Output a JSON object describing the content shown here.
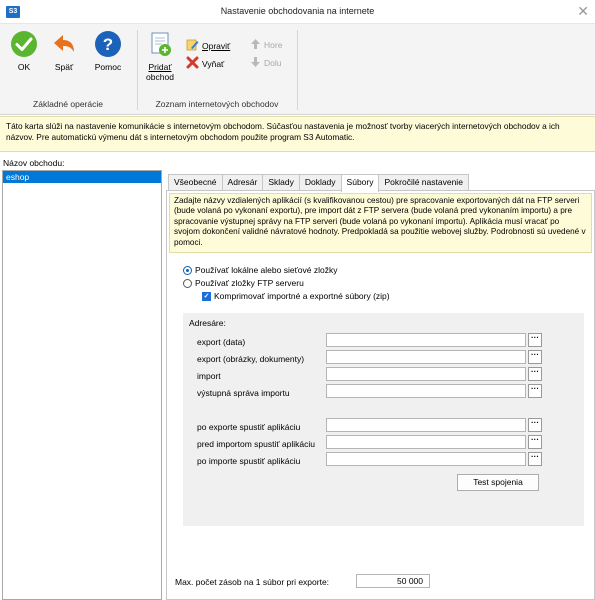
{
  "window": {
    "app_badge": "S3",
    "title": "Nastavenie obchodovania na internete",
    "close_glyph": "✕"
  },
  "ribbon": {
    "basic_group": {
      "label": "Základné operácie",
      "ok": "OK",
      "back": "Späť",
      "help": "Pomoc"
    },
    "shops_group": {
      "label": "Zoznam internetových obchodov",
      "add_line1": "Pridať",
      "add_line2": "obchod",
      "edit": "Opraviť",
      "remove": "Vyňať",
      "up": "Hore",
      "down": "Dolu"
    }
  },
  "info_text": "Táto karta slúži na nastavenie komunikácie s internetovým obchodom. Súčasťou nastavenia je možnosť tvorby viacerých internetových obchodov a ich názvov. Pre automatickú výmenu dát s internetovým obchodom použite program S3 Automatic.",
  "shop_list": {
    "label": "Názov obchodu:",
    "items": [
      "eshop"
    ]
  },
  "tabs": [
    "Všeobecné",
    "Adresár",
    "Sklady",
    "Doklady",
    "Súbory",
    "Pokročilé nastavenie"
  ],
  "active_tab": "Súbory",
  "files_tab": {
    "description": "Zadajte názvy vzdialených aplikácií (s kvalifikovanou cestou) pre spracovanie exportovaných dát na FTP serveri (bude volaná po vykonaní exportu), pre import dát z FTP servera (bude volaná pred vykonaním importu) a pre spracovanie výstupnej správy na FTP serveri (bude volaná po vykonaní importu). Aplikácia musí vracať po svojom dokončení validné návratové hodnoty. Predpokladá sa použitie webovej služby. Podrobnosti sú uvedené v pomoci.",
    "radio_local": "Používať lokálne alebo sieťové zložky",
    "radio_ftp": "Používať zložky FTP serveru",
    "compress": "Komprimovať importné a exportné súbory (zip)",
    "dirs_title": "Adresáre:",
    "fields": {
      "export_data": {
        "label": "export (data)",
        "value": ""
      },
      "export_images": {
        "label": "export (obrázky, dokumenty)",
        "value": ""
      },
      "import": {
        "label": "import",
        "value": ""
      },
      "import_report": {
        "label": "výstupná správa importu",
        "value": ""
      },
      "after_export": {
        "label": "po exporte spustiť aplikáciu",
        "value": ""
      },
      "before_import": {
        "label": "pred importom spustiť aplikáciu",
        "value": ""
      },
      "after_import": {
        "label": "po importe spustiť aplikáciu",
        "value": ""
      }
    },
    "browse_glyph": "···",
    "test_button": "Test spojenia",
    "max_label": "Max. počet zásob na 1 súbor pri exporte:",
    "max_value": "50 000"
  },
  "colors": {
    "accent": "#0078d7",
    "info_bg": "#fdfbd8",
    "ok_green": "#5cb531",
    "back_orange": "#e8711e",
    "help_blue": "#1c62b9"
  },
  "icons": {
    "ok": "check-circle-icon",
    "back": "back-arrow-icon",
    "help": "question-circle-icon",
    "add": "add-document-icon",
    "edit": "edit-icon",
    "remove": "delete-x-icon",
    "up": "arrow-up-icon",
    "down": "arrow-down-icon"
  }
}
